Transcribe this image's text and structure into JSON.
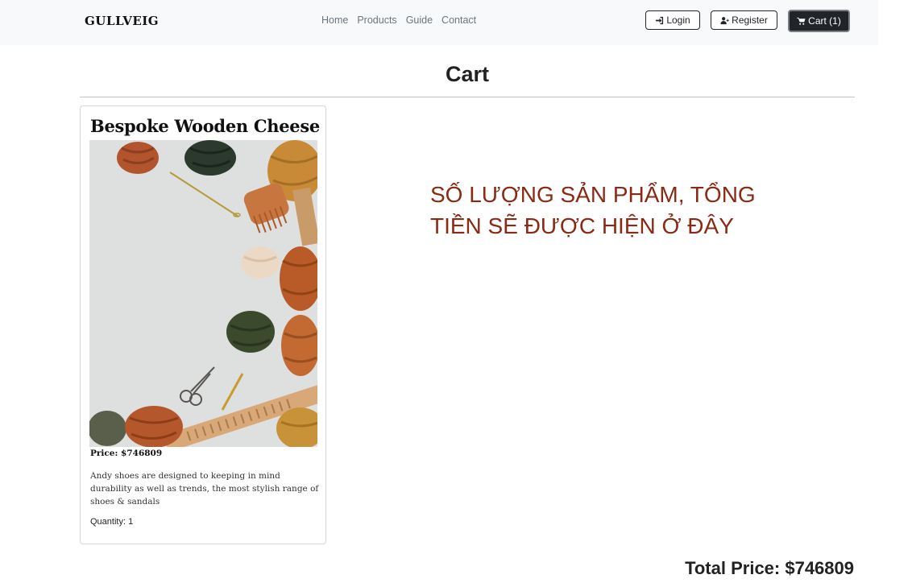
{
  "nav": {
    "brand": "GULLVEIG",
    "links": [
      "Home",
      "Products",
      "Guide",
      "Contact"
    ],
    "login_label": "Login",
    "register_label": "Register",
    "cart_label": "Cart (1)"
  },
  "page": {
    "title": "Cart"
  },
  "cart_item": {
    "name": "Bespoke Wooden Cheese",
    "price_text": "Price: $746809",
    "description": "Andy shoes are designed to keeping in mind durability as well as trends, the most stylish range of shoes & sandals",
    "quantity_text": "Quantity: 1"
  },
  "notice": {
    "line1": "SỐ LƯỢNG SẢN PHẨM, TỔNG",
    "line2": "TIỀN SẼ ĐƯỢC HIỆN Ở ĐÂY"
  },
  "summary": {
    "total_text": "Total Price: $746809"
  },
  "colors": {
    "navbar_bg": "#f8f9fa",
    "dark": "#212529",
    "notice_red": "#8b2a14"
  }
}
